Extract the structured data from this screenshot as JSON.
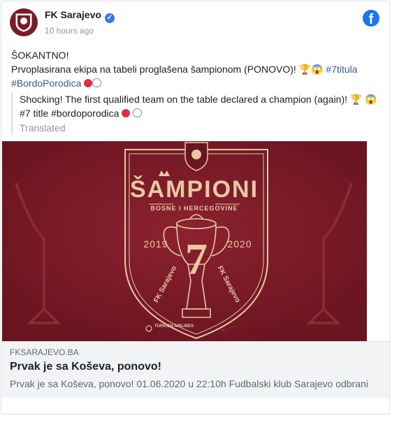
{
  "post": {
    "page_name": "FK Sarajevo",
    "time": "10 hours ago",
    "line1": "ŠOKANTNO!",
    "line2_text": "Prvoplasirana ekipa na tabeli proglašena šampionom (PONOVO)! 🏆😱 ",
    "hashtag1": "#7titula",
    "hashtag2": "#BordoPorodica",
    "translation_text": "Shocking! The first qualified team on the table declared a champion (again)! 🏆 😱 #7 title #bordoporodica",
    "translated_label": "Translated"
  },
  "image": {
    "title": "ŠAMPIONI",
    "subtitle": "BOSNE I HERCEGOVINE",
    "year_left": "2019",
    "year_right": "2020",
    "seven": "7",
    "curve_left": "FK Sarajevo",
    "curve_right": "FK Sarajevo",
    "sponsor": "TURKISH AIRLINES"
  },
  "link_preview": {
    "domain": "FKSARAJEVO.BA",
    "title": "Prvak je sa Koševa, ponovo!",
    "description": "Prvak je sa Koševa, ponovo! 01.06.2020 u 22:10h Fudbalski klub Sarajevo odbrani"
  },
  "colors": {
    "maroon": "#7b1b26",
    "gold": "#e7c9a3",
    "link_blue": "#385898",
    "facebook_blue": "#1877f2"
  },
  "icons": [
    "club-logo-icon",
    "verified-badge-icon",
    "facebook-icon",
    "nike-swoosh-icon",
    "turkish-airlines-icon"
  ]
}
